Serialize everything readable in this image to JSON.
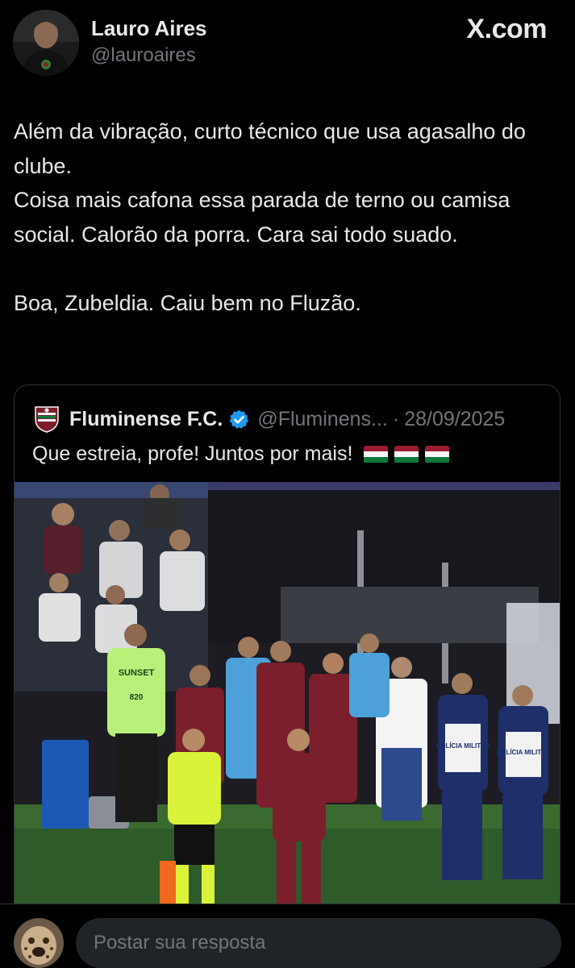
{
  "author": {
    "name": "Lauro Aires",
    "handle": "@lauroaires"
  },
  "brand": {
    "label": "X.com"
  },
  "post": {
    "paragraphs": [
      "Além da vibração, curto técnico que usa agasalho do clube.",
      "Coisa mais cafona essa parada de terno ou camisa social. Calorão da porra. Cara sai todo suado.",
      "Boa, Zubeldia. Caiu bem no Fluzão."
    ]
  },
  "quote": {
    "name": "Fluminense F.C.",
    "handle": "@Fluminens...",
    "separator": "·",
    "date": "28/09/2025",
    "text": "Que estreia, profe! Juntos por mais!",
    "flag_count": 3,
    "colors": {
      "maroon": "#7a1f2b",
      "green": "#0f7a3a",
      "white": "#fafafa",
      "verified": "#1d9bf0"
    },
    "media": {
      "jersey_texts": [
        "SUNSET",
        "820",
        "POLÍCIA MILITAR",
        "POLÍCIA MILITAR"
      ]
    }
  },
  "reply": {
    "placeholder": "Postar sua resposta"
  },
  "colors": {
    "background": "#000000",
    "text_primary": "#e7e9ea",
    "text_secondary": "#71767b",
    "border": "#2f3336",
    "input_bg": "#202327"
  }
}
